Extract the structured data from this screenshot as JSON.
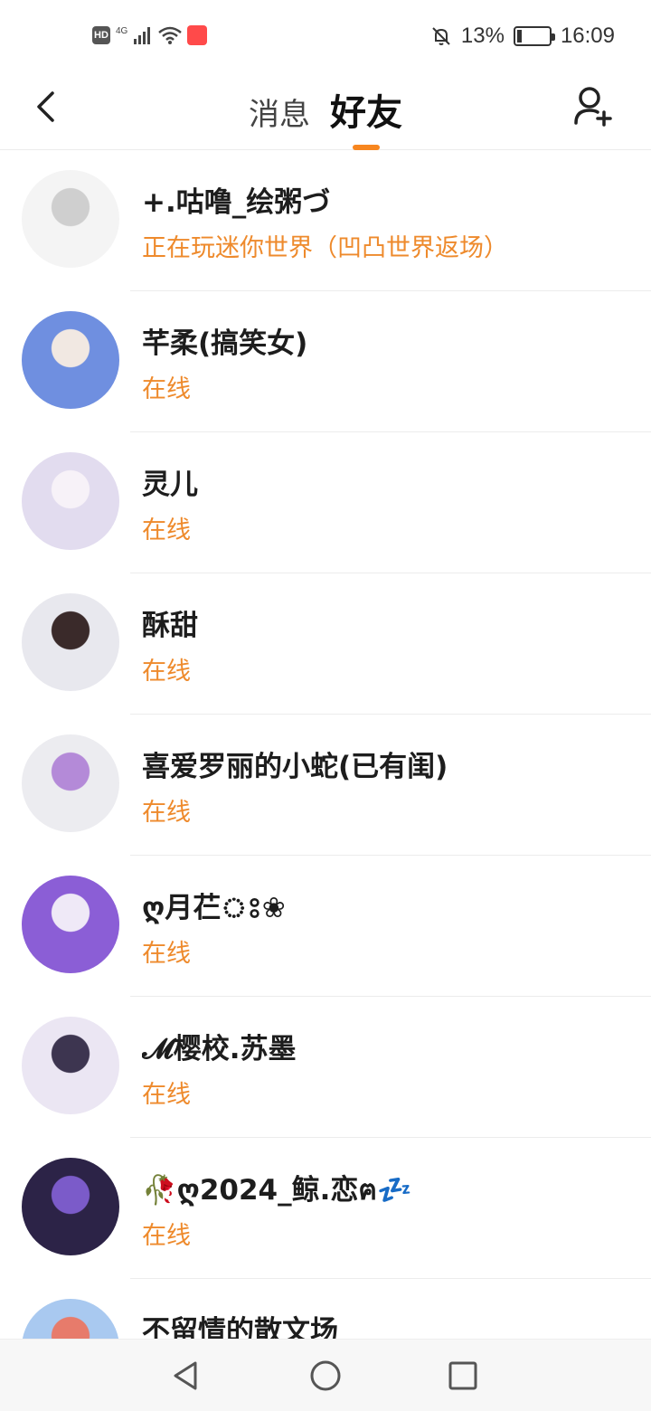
{
  "status_bar": {
    "hd": "HD",
    "network": "4G",
    "battery_text": "13%",
    "battery_level": 0.13,
    "time": "16:09",
    "icons": [
      "signal-icon",
      "wifi-icon",
      "app-notify-icon",
      "mute-bell-icon",
      "battery-icon"
    ]
  },
  "header": {
    "tabs": [
      {
        "label": "消息",
        "active": false
      },
      {
        "label": "好友",
        "active": true
      }
    ],
    "accent_color": "#f7861f"
  },
  "friends": [
    {
      "name": "+.咕噜_绘粥づ",
      "status": "正在玩迷你世界（凹凸世界返场）",
      "avatar_colors": [
        "#f4f4f4",
        "#cfcfcf"
      ]
    },
    {
      "name": "芊柔(搞笑女)",
      "status": "在线",
      "avatar_colors": [
        "#6f8fe0",
        "#f1e8e2"
      ]
    },
    {
      "name": "灵儿",
      "status": "在线",
      "avatar_colors": [
        "#e2dcef",
        "#f7f2f8"
      ]
    },
    {
      "name": "酥甜",
      "status": "在线",
      "avatar_colors": [
        "#e8e8ee",
        "#3a2a2a"
      ]
    },
    {
      "name": "喜爱罗丽的小蛇(已有闺)",
      "status": "在线",
      "avatar_colors": [
        "#ececf0",
        "#b48ad8"
      ]
    },
    {
      "name": "ღ月芢ঃ❀",
      "status": "在线",
      "avatar_colors": [
        "#8b5ed6",
        "#efe9f7"
      ]
    },
    {
      "name": "𝓜樱校.苏墨",
      "status": "在线",
      "avatar_colors": [
        "#ebe6f3",
        "#3d3550"
      ]
    },
    {
      "name": "🥀ღ2024_鲸.恋ฅ💤",
      "status": "在线",
      "avatar_colors": [
        "#2c2347",
        "#7b5bc9"
      ]
    },
    {
      "name": "不留情的散文场",
      "status": "",
      "avatar_colors": [
        "#a9c9f0",
        "#e77b6b"
      ]
    }
  ],
  "status_color": "#ee8a2c"
}
